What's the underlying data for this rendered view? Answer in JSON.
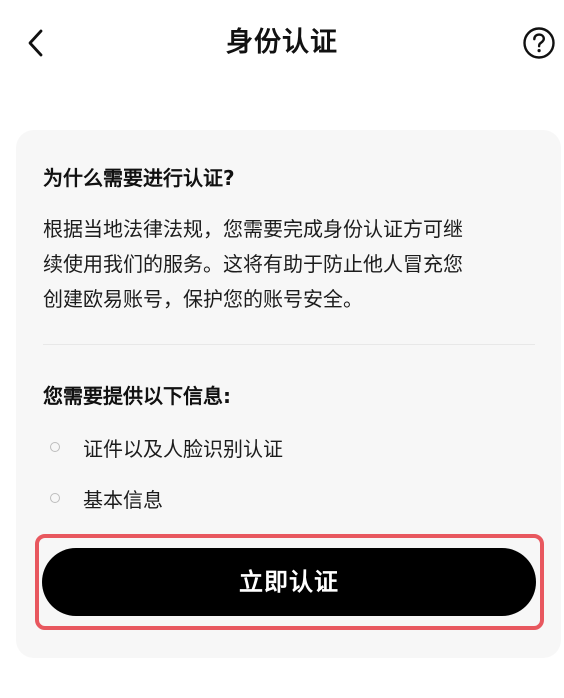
{
  "header": {
    "title": "身份认证",
    "back_icon": "chevron-left-icon",
    "help_icon": "question-circle-icon"
  },
  "card": {
    "question_title": "为什么需要进行认证?",
    "description_lines": [
      "根据当地法律法规，您需要完成身份认证方可继",
      "续使用我们的服务。这将有助于防止他人冒充您",
      "创建欧易账号，保护您的账号安全。"
    ],
    "info_title": "您需要提供以下信息:",
    "requirements": [
      "证件以及人脸识别认证",
      "基本信息"
    ]
  },
  "cta": {
    "label": "立即认证"
  },
  "colors": {
    "highlight": "#e8585f",
    "button_bg": "#000000",
    "card_bg": "#f7f7f7"
  }
}
